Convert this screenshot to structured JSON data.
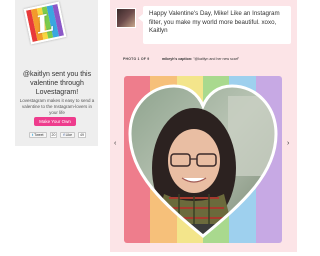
{
  "logo": {
    "letter": "L",
    "stripes": [
      "#e83a3a",
      "#f39a2b",
      "#f7d640",
      "#7ccb4b",
      "#3aa7e0",
      "#8b58c8"
    ]
  },
  "left": {
    "sent_text": "@kaitlyn sent you this valentine through Lovestagram!",
    "sub_text": "Lovestagram makes it easy to send a valentine to the Instagram-lovers in your life",
    "make_button": "Make Your Own",
    "tweet_label": "Tweet",
    "tweet_count": "20",
    "like_label": "Like",
    "like_count": "49"
  },
  "message": {
    "text": "Happy Valentine's Day, Mike! Like an Instagram filter, you make my world more beautiful. xoxo, Kaitlyn"
  },
  "photo": {
    "position": "PHOTO 1 OF 9",
    "caption_user": "mikeyh's caption:",
    "caption_text": "\"@kaitlyn and her new scarf\"",
    "prev_arrow": "‹",
    "next_arrow": "›",
    "band_colors": [
      "#ee7d8c",
      "#f6c07a",
      "#f3e58b",
      "#a9d98e",
      "#9ed0ee",
      "#c7a9e4"
    ]
  }
}
